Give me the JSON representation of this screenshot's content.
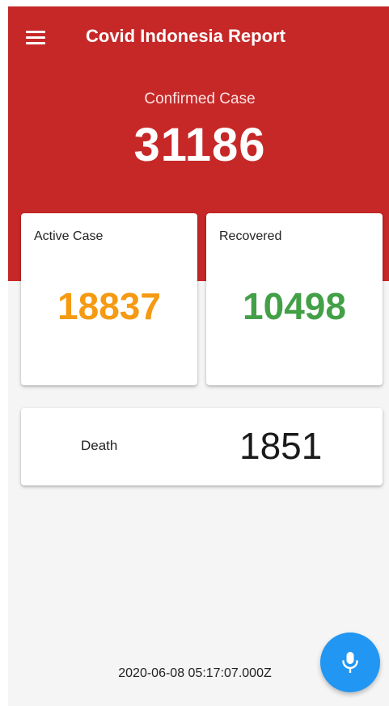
{
  "app_bar": {
    "title": "Covid Indonesia Report",
    "menu_icon": "hamburger-menu-icon"
  },
  "summary": {
    "confirmed_label": "Confirmed Case",
    "confirmed_value": "31186"
  },
  "cards": {
    "active": {
      "label": "Active Case",
      "value": "18837",
      "color": "#f59a12"
    },
    "recovered": {
      "label": "Recovered",
      "value": "10498",
      "color": "#43a047"
    },
    "death": {
      "label": "Death",
      "value": "1851"
    }
  },
  "footer": {
    "timestamp": "2020-06-08 05:17:07.000Z"
  },
  "fab": {
    "icon": "microphone-icon"
  },
  "colors": {
    "header": "#c62828",
    "background": "#f5f5f5",
    "fab": "#2196f3"
  }
}
